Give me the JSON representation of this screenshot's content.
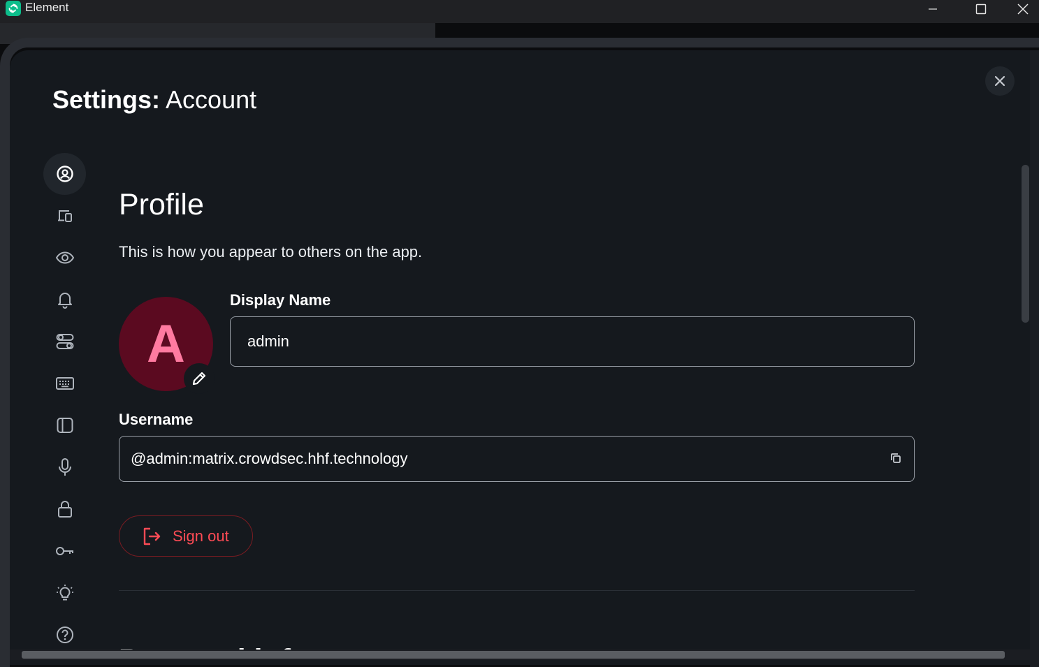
{
  "window": {
    "title": "Element"
  },
  "dialog": {
    "title_bold": "Settings:",
    "title_rest": "Account",
    "close_label": "×"
  },
  "nav": {
    "items": [
      {
        "icon": "account-icon",
        "active": true
      },
      {
        "icon": "sessions-icon"
      },
      {
        "icon": "appearance-icon"
      },
      {
        "icon": "notifications-icon"
      },
      {
        "icon": "preferences-icon"
      },
      {
        "icon": "keyboard-icon"
      },
      {
        "icon": "sidebar-icon"
      },
      {
        "icon": "voice-video-icon"
      },
      {
        "icon": "security-privacy-icon"
      },
      {
        "icon": "encryption-key-icon"
      },
      {
        "icon": "labs-icon"
      },
      {
        "icon": "help-about-icon"
      }
    ]
  },
  "profile": {
    "heading": "Profile",
    "subtitle": "This is how you appear to others on the app.",
    "avatar_letter": "A",
    "display_name_label": "Display Name",
    "display_name_value": "admin",
    "username_label": "Username",
    "username_value": "@admin:matrix.crowdsec.hhf.technology",
    "sign_out_label": "Sign out"
  },
  "next_section_heading": "Personal info",
  "colors": {
    "background": "#15191e",
    "accent_danger": "#ff4b55",
    "avatar_bg": "#5b0a20",
    "avatar_fg": "#ff7aa0",
    "brand": "#0dbd8b"
  }
}
